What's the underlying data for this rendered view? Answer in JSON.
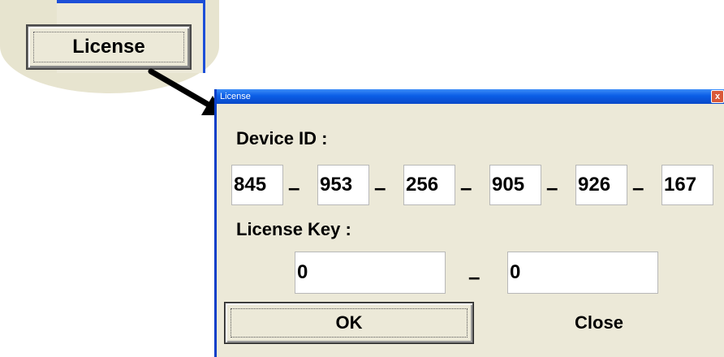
{
  "callout": {
    "button_label": "License"
  },
  "dialog": {
    "title": "License",
    "close_glyph": "x",
    "device_id_label": "Device ID :",
    "device_id": [
      "845",
      "953",
      "256",
      "905",
      "926",
      "167"
    ],
    "separator": "–",
    "license_key_label": "License Key :",
    "license_key": [
      "0",
      "0"
    ],
    "ok_label": "OK",
    "close_label": "Close"
  },
  "colors": {
    "dialog_bg": "#ece9d8",
    "titlebar": "#0a5ee6",
    "window_border": "#0a3fc8",
    "callout_bg": "#e7e4cf",
    "close_button": "#d9593a"
  }
}
